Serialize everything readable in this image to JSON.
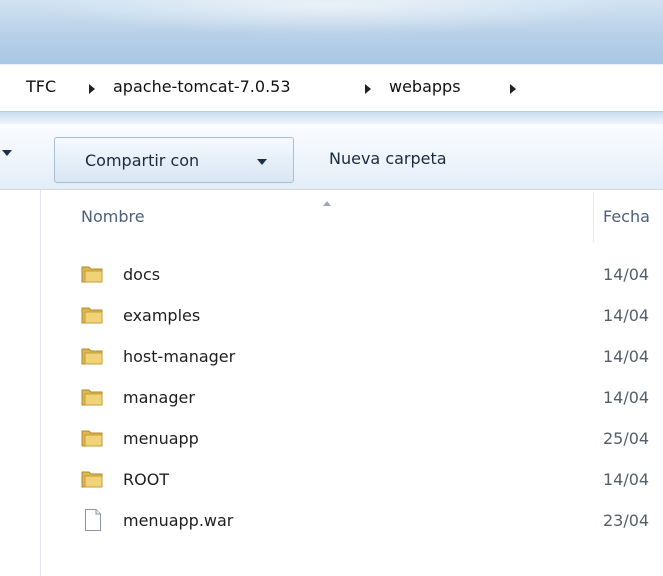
{
  "breadcrumb": [
    "TFC",
    "apache-tomcat-7.0.53",
    "webapps"
  ],
  "toolbar": {
    "share_label": "Compartir con",
    "new_folder_label": "Nueva carpeta"
  },
  "columns": {
    "name": "Nombre",
    "date": "Fecha"
  },
  "files": [
    {
      "name": "docs",
      "date": "14/04",
      "type": "folder"
    },
    {
      "name": "examples",
      "date": "14/04",
      "type": "folder"
    },
    {
      "name": "host-manager",
      "date": "14/04",
      "type": "folder"
    },
    {
      "name": "manager",
      "date": "14/04",
      "type": "folder"
    },
    {
      "name": "menuapp",
      "date": "25/04",
      "type": "folder"
    },
    {
      "name": "ROOT",
      "date": "14/04",
      "type": "folder"
    },
    {
      "name": "menuapp.war",
      "date": "23/04",
      "type": "file"
    }
  ],
  "icons": [
    "folder-icon",
    "file-icon",
    "breadcrumb-arrow-icon",
    "chevron-down-icon",
    "sort-ascending-icon"
  ],
  "colors": {
    "toolbar_bg": "#e3edf8",
    "titlebar": "#bcd3e9",
    "header_text": "#4c607a"
  }
}
